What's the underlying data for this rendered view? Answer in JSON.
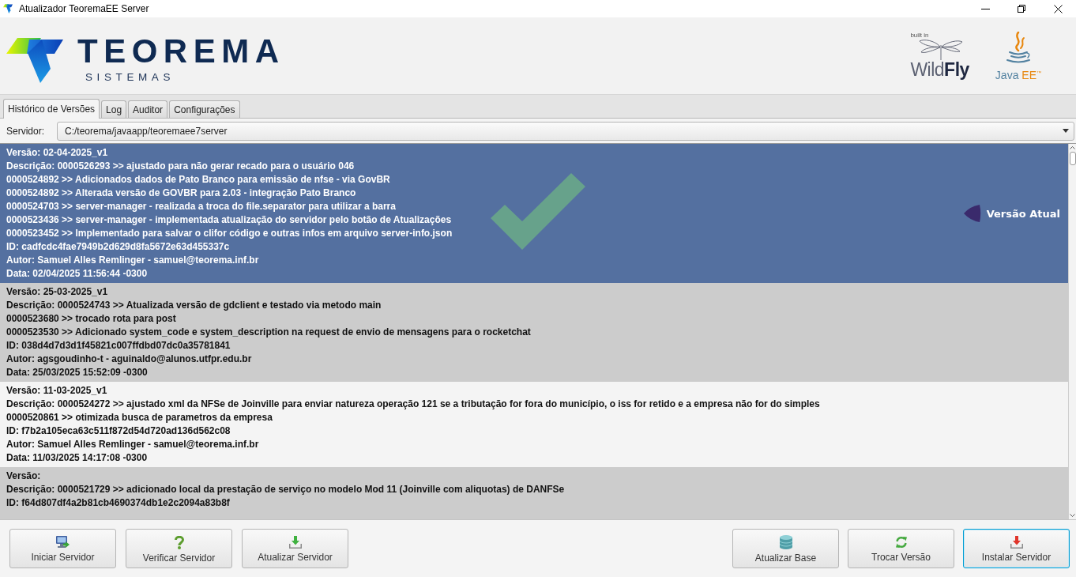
{
  "window": {
    "title": "Atualizador TeoremaEE Server"
  },
  "header": {
    "logo": {
      "wordmark": "TEOREMA",
      "tagline": "SISTEMAS"
    },
    "partner_logos": [
      {
        "kind": "wildfly",
        "caption": "built in",
        "wordmark": [
          "Wild",
          "Fly"
        ]
      },
      {
        "kind": "javaee",
        "wordmark": [
          "Java",
          "EE$^{™}$"
        ]
      }
    ]
  },
  "tabs": [
    {
      "label": "Histórico de Versões",
      "selected": true
    },
    {
      "label": "Log",
      "selected": false
    },
    {
      "label": "Auditor",
      "selected": false
    },
    {
      "label": "Configurações",
      "selected": false
    }
  ],
  "server": {
    "label": "Servidor:",
    "value": "C:/teorema/javaapp/teoremaee7server"
  },
  "versions": [
    {
      "selected": true,
      "current": true,
      "badge": "Versão Atual",
      "version": "Versão: 02-04-2025_v1",
      "description": [
        "Descrição: 0000526293 >> ajustado para não gerar recado para o usuário 046",
        "0000524892 >> Adicionados dados de Pato Branco para emissão de nfse - via GovBR",
        "0000524892 >> Alterada versão de GOVBR para 2.03 - integração Pato Branco",
        "0000524703 >> server-manager - realizada a troca do file.separator para utilizar a barra",
        "0000523436 >> server-manager - implementada atualização do servidor pelo botão de Atualizações",
        "0000523452 >> Implementado para salvar o clifor código e outras infos em arquivo server-info.json"
      ],
      "id": "ID: cadfcdc4fae7949b2d629d8fa5672e63d455337c",
      "author": "Autor: Samuel Alles Remlinger - samuel@teorema.inf.br",
      "date": "Data: 02/04/2025 11:56:44 -0300"
    },
    {
      "selected": false,
      "current": false,
      "version": "Versão: 25-03-2025_v1",
      "description": [
        "Descrição: 0000524743 >> Atualizada versão de gdclient e testado via metodo main",
        "0000523680 >> trocado rota para post",
        "0000523530 >> Adicionado system_code e system_description na request de envio de mensagens para o rocketchat"
      ],
      "id": "ID: 038d4d7d3d1f45821c007ffdbd07dc0a35781841",
      "author": "Autor: agsgoudinho-t - aguinaldo@alunos.utfpr.edu.br",
      "date": "Data: 25/03/2025 15:52:09 -0300"
    },
    {
      "selected": false,
      "current": false,
      "version": "Versão: 11-03-2025_v1",
      "description": [
        "Descrição: 0000524272 >> ajustado xml da NFSe de Joinville para enviar natureza operação 121 se a tributação for fora do município, o iss for retido e a empresa não for do simples",
        "0000520861 >> otimizada busca de parametros da empresa"
      ],
      "id": "ID: f7b2a105eca63c511f872d54d720ad136d562c08",
      "author": "Autor: Samuel Alles Remlinger - samuel@teorema.inf.br",
      "date": "Data: 11/03/2025 14:17:08 -0300"
    },
    {
      "selected": false,
      "current": false,
      "version": "Versão:",
      "description": [
        "Descrição: 0000521729 >> adicionado local da prestação de serviço no modelo Mod 11 (Joinville com aliquotas) de DANFSe"
      ],
      "id": "ID: f64d807df4a2b81cb4690374db1e2c2094a83b8f"
    }
  ],
  "actions": {
    "left": [
      {
        "kind": "start",
        "label": "Iniciar Servidor",
        "focused": false
      },
      {
        "kind": "verify",
        "label": "Verificar Servidor",
        "focused": false
      },
      {
        "kind": "update",
        "label": "Atualizar Servidor",
        "focused": false
      }
    ],
    "right": [
      {
        "kind": "database",
        "label": "Atualizar Base",
        "focused": false
      },
      {
        "kind": "switch",
        "label": "Trocar Versão",
        "focused": false
      },
      {
        "kind": "install",
        "label": "Instalar Servidor",
        "focused": true
      }
    ]
  }
}
